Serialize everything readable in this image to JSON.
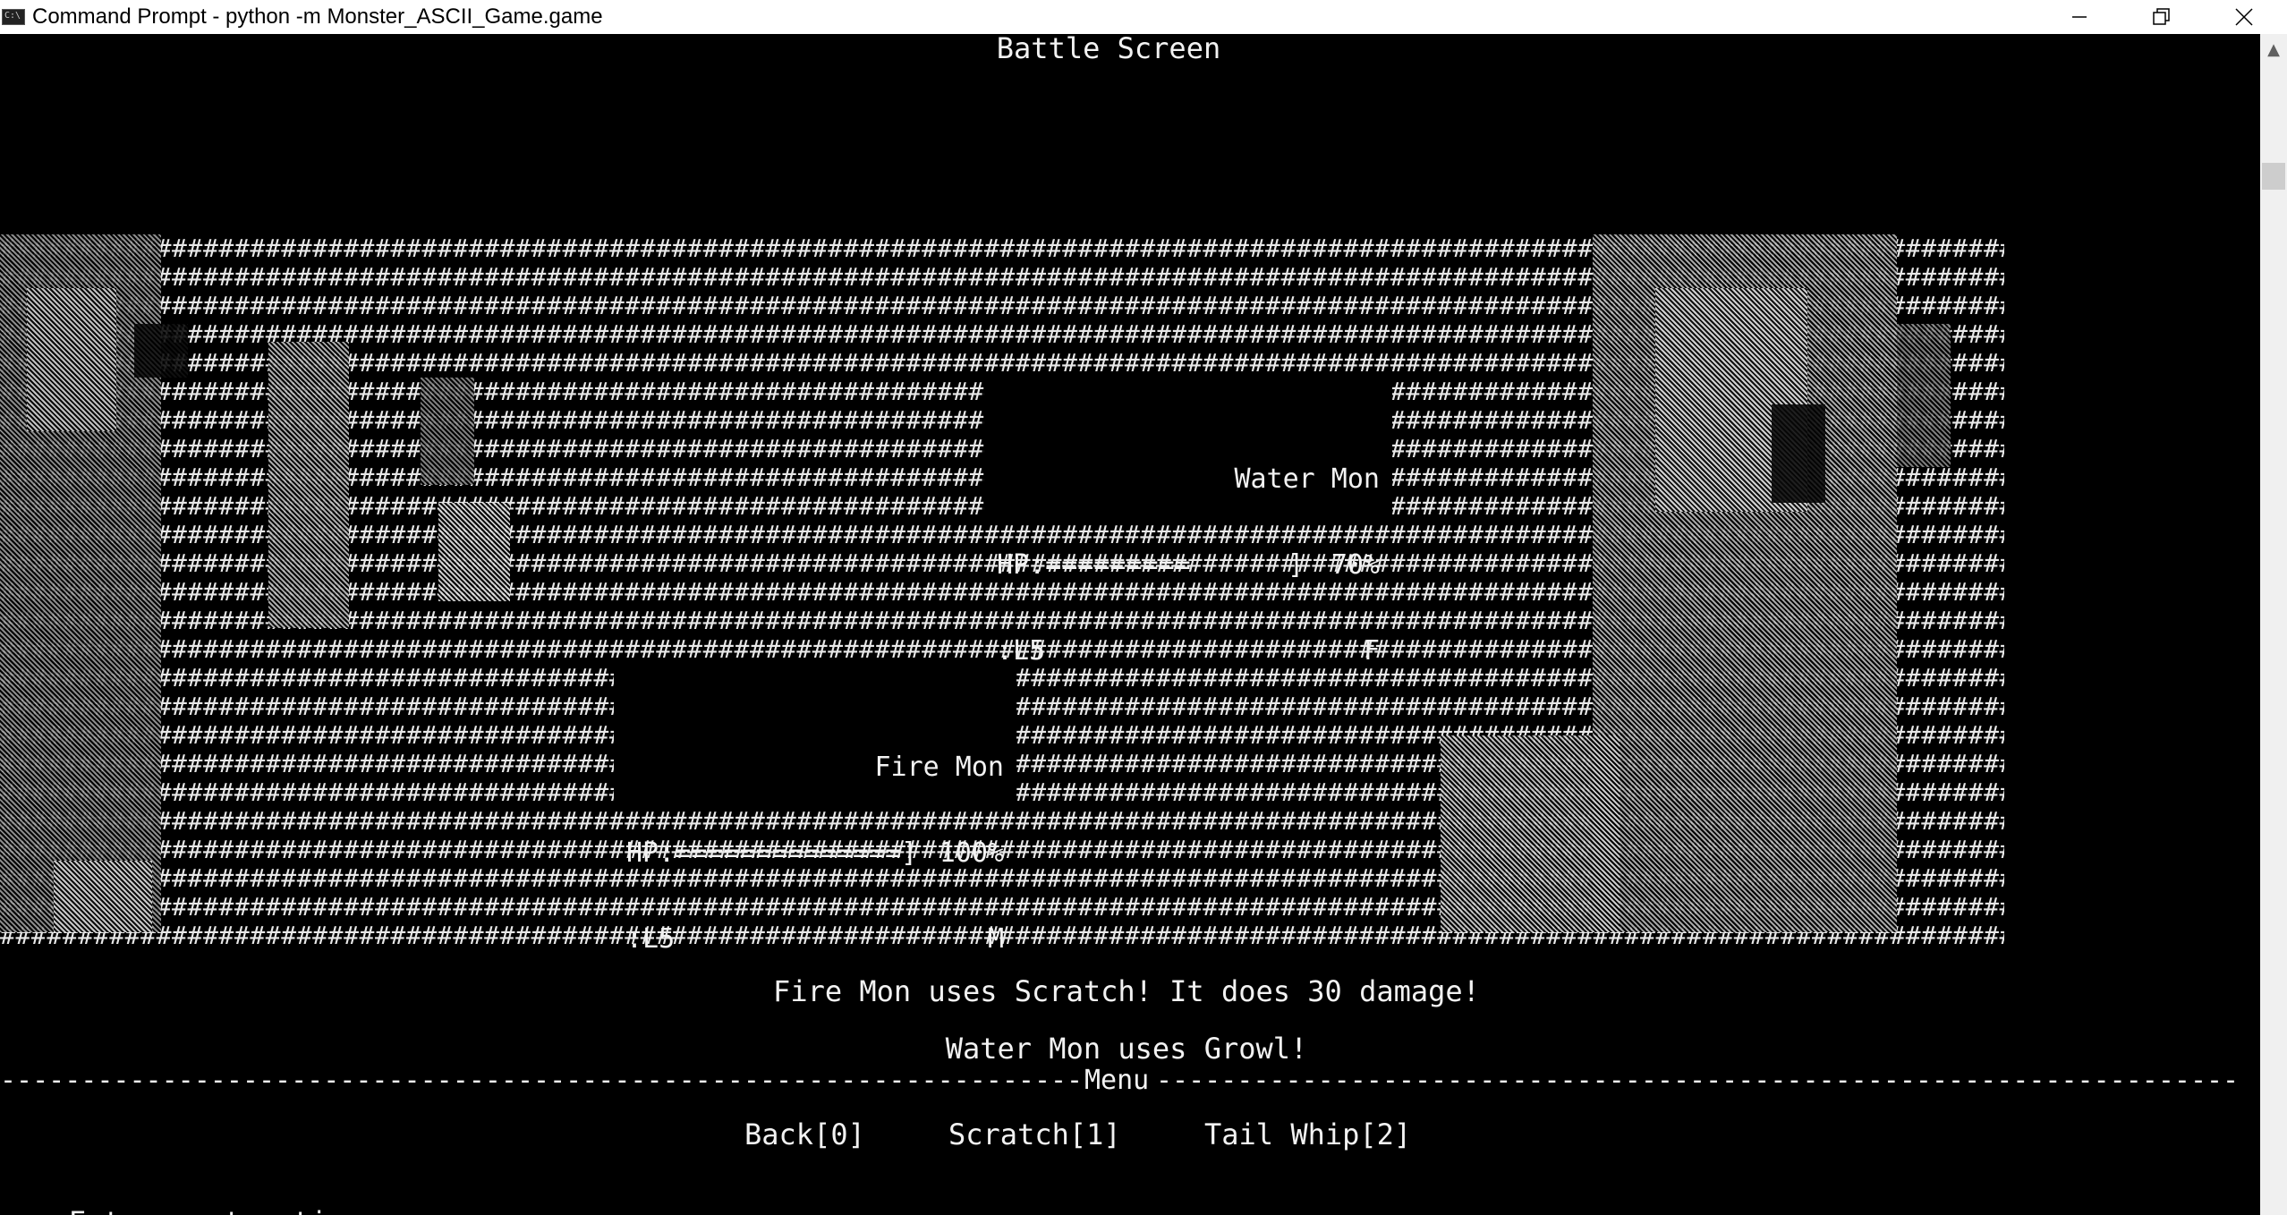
{
  "window": {
    "title": "Command Prompt - python  -m Monster_ASCII_Game.game",
    "app_icon_text": "C:\\",
    "minimize_icon": "minimize-icon",
    "restore_icon": "restore-icon",
    "close_icon": "close-icon"
  },
  "screen_title": "Battle Screen",
  "enemy": {
    "name": "Water Mon",
    "hp_bar": "HP:=========      ]",
    "hp_percent": "70%",
    "level": ":L5",
    "gender": "F"
  },
  "player": {
    "name": "Fire Mon",
    "hp_bar": "HP:==============]",
    "hp_percent": "100%",
    "level": ":L5",
    "gender": "M"
  },
  "messages": [
    "Fire Mon uses Scratch! It does 30 damage!",
    "Water Mon uses Growl!"
  ],
  "menu": {
    "label": "Menu",
    "options": [
      "Back[0]",
      "Scratch[1]",
      "Tail Whip[2]"
    ]
  },
  "prompt": "Enter next action: ",
  "colors": {
    "console_bg": "#000000",
    "console_fg": "#f2f2f2",
    "titlebar_bg": "#ffffff"
  }
}
